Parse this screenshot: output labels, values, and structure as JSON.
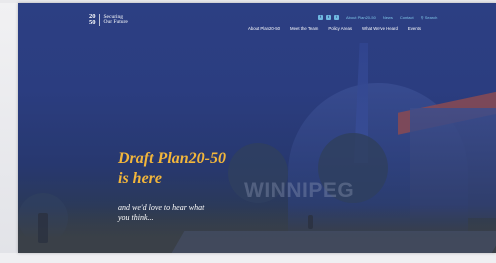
{
  "logo": {
    "mark_top": "20",
    "mark_bottom": "50",
    "text_line1": "Securing",
    "text_line2": "Our Future"
  },
  "utility": {
    "social_icons": [
      "facebook-icon",
      "twitter-icon",
      "instagram-icon"
    ],
    "links": [
      "About Plan20-50",
      "News",
      "Contact"
    ],
    "search_label": "Search"
  },
  "nav": {
    "items": [
      "About Plan20-50",
      "Meet the Team",
      "Policy Areas",
      "What We've Heard",
      "Events"
    ]
  },
  "hero": {
    "title_line1": "Draft Plan20-50",
    "title_line2": "is here",
    "subtitle_line1": "and we'd love to hear what",
    "subtitle_line2": "you think...",
    "watermark": "WINNIPEG"
  },
  "colors": {
    "overlay": "#2c3f83",
    "accent": "#f2b63b",
    "utility_link": "#7fc4e6"
  }
}
